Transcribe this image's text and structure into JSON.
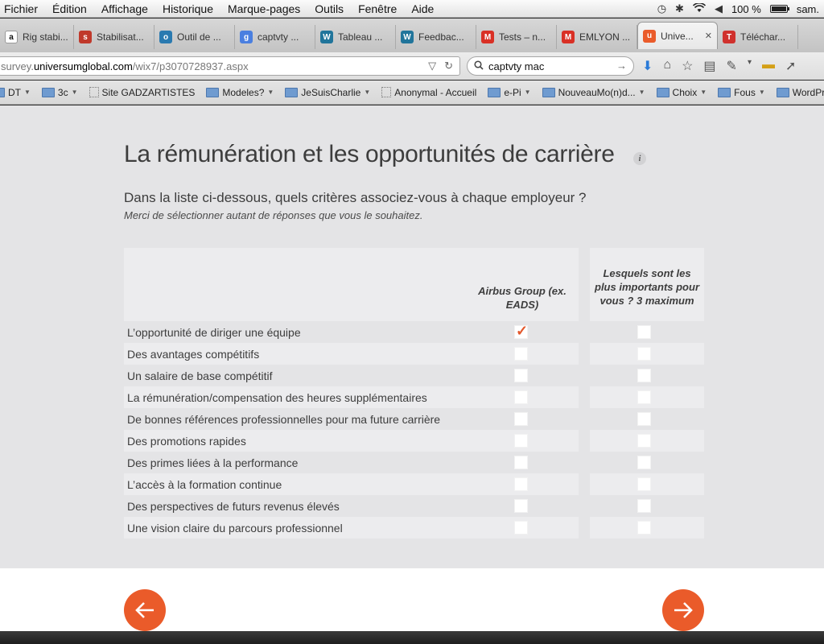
{
  "menubar": {
    "items": [
      "Fichier",
      "Édition",
      "Affichage",
      "Historique",
      "Marque-pages",
      "Outils",
      "Fenêtre",
      "Aide"
    ],
    "battery": "100 %",
    "battery_level": 1.0,
    "user": "sam."
  },
  "tabs": [
    {
      "label": "Rig stabi...",
      "icon": "amazon-icon",
      "color": "#ffffff",
      "glyph": "a"
    },
    {
      "label": "Stabilisat...",
      "icon": "site-icon",
      "color": "#c0392b",
      "glyph": "s"
    },
    {
      "label": "Outil de ...",
      "icon": "tool-icon",
      "color": "#2a7ab0",
      "glyph": "o"
    },
    {
      "label": "captvty ...",
      "icon": "google-icon",
      "color": "#4a7fe0",
      "glyph": "g"
    },
    {
      "label": "Tableau ...",
      "icon": "wordpress-icon",
      "color": "#21759b",
      "glyph": "W"
    },
    {
      "label": "Feedbac...",
      "icon": "wordpress-icon",
      "color": "#21759b",
      "glyph": "W"
    },
    {
      "label": "Tests – n...",
      "icon": "gmail-icon",
      "color": "#d93025",
      "glyph": "M"
    },
    {
      "label": "EMLYON ...",
      "icon": "gmail-icon",
      "color": "#d93025",
      "glyph": "M"
    },
    {
      "label": "Unive...",
      "icon": "universum-icon",
      "color": "#ea5b2a",
      "glyph": "u",
      "active": true,
      "close": "✕"
    },
    {
      "label": "Téléchar...",
      "icon": "download-site-icon",
      "color": "#d0312d",
      "glyph": "T"
    }
  ],
  "urlbar": {
    "prefix": "survey.",
    "domain": "universumglobal.com",
    "path": "/wix7/p3070728937.aspx"
  },
  "search": {
    "value": "captvty mac"
  },
  "bookmarks": [
    {
      "label": "DT",
      "type": "folder"
    },
    {
      "label": "3c",
      "type": "folder"
    },
    {
      "label": "Site GADZARTISTES",
      "type": "page"
    },
    {
      "label": "Modeles?",
      "type": "folder"
    },
    {
      "label": "JeSuisCharlie",
      "type": "folder"
    },
    {
      "label": "Anonymal - Accueil",
      "type": "page"
    },
    {
      "label": "e-Pi",
      "type": "folder"
    },
    {
      "label": "NouveauMo(n)d...",
      "type": "folder"
    },
    {
      "label": "Choix",
      "type": "folder"
    },
    {
      "label": "Fous",
      "type": "folder"
    },
    {
      "label": "WordPre",
      "type": "folder"
    }
  ],
  "survey": {
    "title": "La rémunération et les opportunités de carrière",
    "info": "i",
    "question": "Dans la liste ci-dessous, quels critères associez-vous à chaque employeur ?",
    "instruction": "Merci de sélectionner autant de réponses que vous le souhaitez.",
    "col1_header": "Airbus Group (ex. EADS)",
    "col2_header": "Lesquels sont les plus importants pour vous ? 3 maximum",
    "rows": [
      {
        "label": "L’opportunité de diriger une équipe",
        "col1": true,
        "col2": false
      },
      {
        "label": "Des avantages compétitifs",
        "col1": false,
        "col2": false
      },
      {
        "label": "Un salaire de base compétitif",
        "col1": false,
        "col2": false
      },
      {
        "label": "La rémunération/compensation des heures supplémentaires",
        "col1": false,
        "col2": false
      },
      {
        "label": "De bonnes références professionnelles pour ma future carrière",
        "col1": false,
        "col2": false
      },
      {
        "label": "Des promotions rapides",
        "col1": false,
        "col2": false
      },
      {
        "label": "Des primes liées à la performance",
        "col1": false,
        "col2": false
      },
      {
        "label": "L’accès à la formation continue",
        "col1": false,
        "col2": false
      },
      {
        "label": "Des perspectives de futurs revenus élevés",
        "col1": false,
        "col2": false
      },
      {
        "label": "Une vision claire du parcours professionnel",
        "col1": false,
        "col2": false
      }
    ]
  },
  "colors": {
    "accent": "#ea5b2a",
    "page_bg": "#e4e4e6",
    "text": "#3d3d3d"
  }
}
